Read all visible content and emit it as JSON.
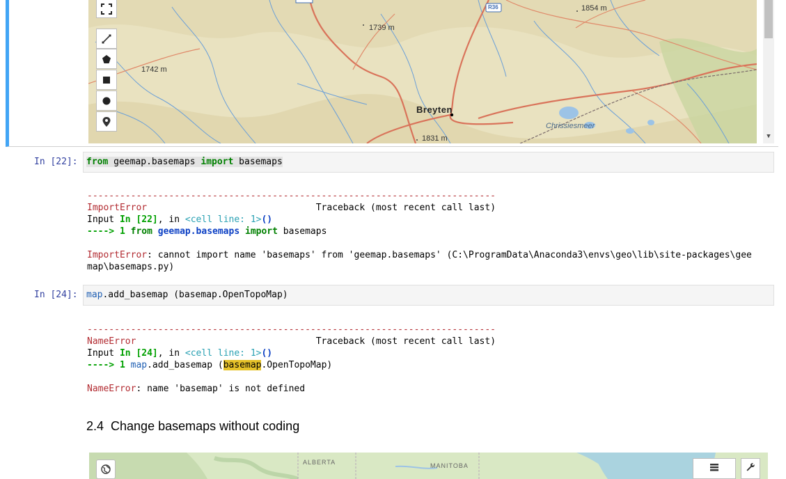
{
  "top_map": {
    "elevation_labels": [
      "1854 m",
      "1739 m",
      "1742 m",
      "1831 m"
    ],
    "road_shield": "R36",
    "city": "Breyten",
    "lake": "Chrissiesmeer",
    "tool_icons": [
      "fullscreen-icon",
      "polyline-icon",
      "polygon-icon",
      "rectangle-icon",
      "circle-icon",
      "marker-icon"
    ]
  },
  "cell22": {
    "prompt": "In [22]:",
    "code_kw1": "from",
    "code_mod": " geemap.basemaps ",
    "code_kw2": "import",
    "code_name": " basemaps",
    "dashes": "---------------------------------------------------------------------------",
    "err_name": "ImportError",
    "traceback": "Traceback (most recent call last)",
    "input_prefix": "Input ",
    "input_in": "In [22]",
    "input_mid": ", in ",
    "cell_line": "<cell line: 1>",
    "parens": "()",
    "arrow": "----> 1 ",
    "arrow_from": "from",
    "arrow_mod": "geemap.basemaps",
    "arrow_import": "import",
    "arrow_name": " basemaps",
    "msg_line1": ": cannot import name 'basemaps' from 'geemap.basemaps' (C:\\ProgramData\\Anaconda3\\envs\\geo\\lib\\site-packages\\gee",
    "msg_line2": "map\\basemaps.py)"
  },
  "cell24": {
    "prompt": "In [24]:",
    "code_obj": "map",
    "code_rest": ".add_basemap (basemap.OpenTopoMap)",
    "dashes": "---------------------------------------------------------------------------",
    "err_name": "NameError",
    "traceback": "Traceback (most recent call last)",
    "input_prefix": "Input ",
    "input_in": "In [24]",
    "input_mid": ", in ",
    "cell_line": "<cell line: 1>",
    "parens": "()",
    "arrow": "----> 1 ",
    "arrow_obj": "map",
    "arrow_call": ".add_basemap (",
    "arrow_hl": "basemap",
    "arrow_tail": ".OpenTopoMap)",
    "msg": ": name 'basemap' is not defined"
  },
  "heading": "2.4  Change basemaps without coding",
  "bottom_map": {
    "labels": [
      "ALBERTA",
      "MANITOBA"
    ],
    "left_button_icon": "globe-icon",
    "right_button_icons": [
      "layers-icon",
      "wrench-icon"
    ]
  },
  "colors": {
    "cell_accent": "#42a5f5",
    "error_red": "#b22b31",
    "keyword_green": "#008000",
    "highlight": "#e6c229"
  }
}
